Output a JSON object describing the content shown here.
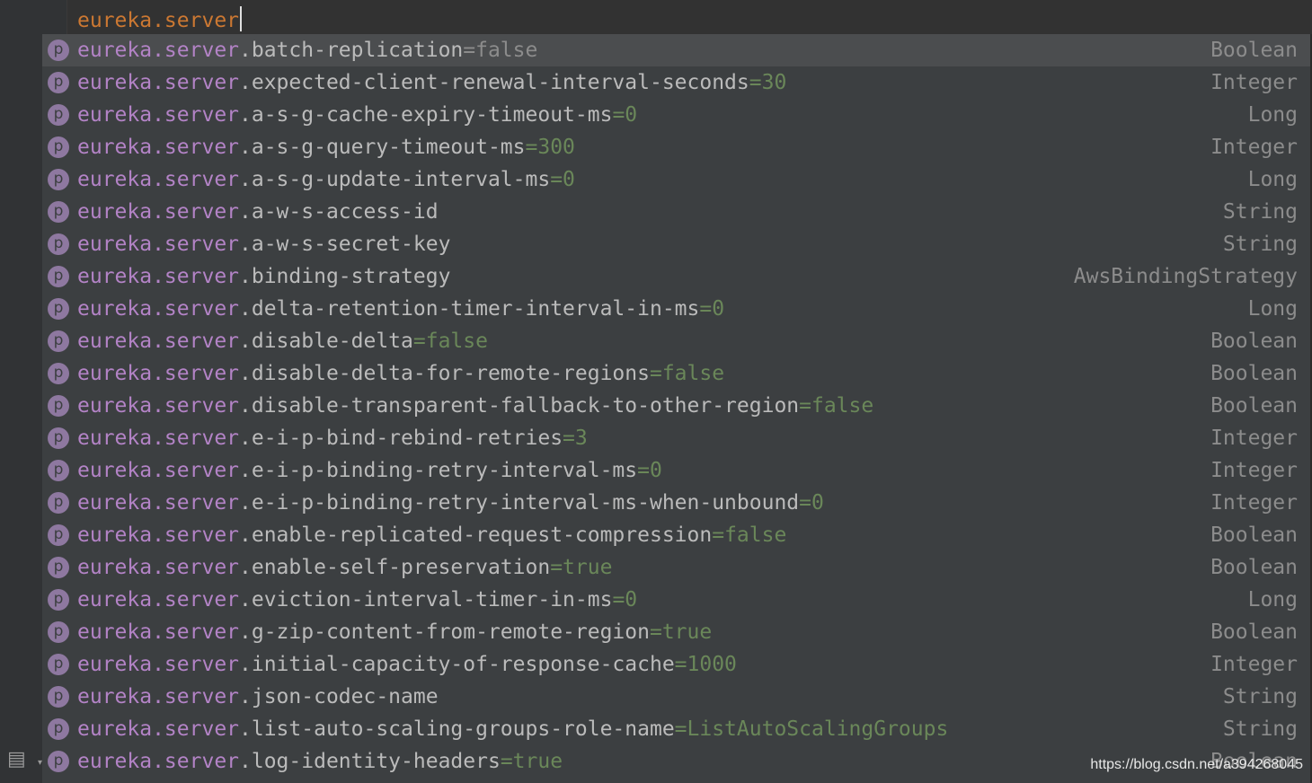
{
  "editor": {
    "typed_text": "eureka.server"
  },
  "completion": {
    "prefix": "eureka.server",
    "items": [
      {
        "suffix": ".batch-replication",
        "value": "=false",
        "type": "Boolean",
        "selected": true
      },
      {
        "suffix": ".expected-client-renewal-interval-seconds",
        "value": "=30",
        "type": "Integer"
      },
      {
        "suffix": ".a-s-g-cache-expiry-timeout-ms",
        "value": "=0",
        "type": "Long"
      },
      {
        "suffix": ".a-s-g-query-timeout-ms",
        "value": "=300",
        "type": "Integer"
      },
      {
        "suffix": ".a-s-g-update-interval-ms",
        "value": "=0",
        "type": "Long"
      },
      {
        "suffix": ".a-w-s-access-id",
        "value": "",
        "type": "String"
      },
      {
        "suffix": ".a-w-s-secret-key",
        "value": "",
        "type": "String"
      },
      {
        "suffix": ".binding-strategy",
        "value": "",
        "type": "AwsBindingStrategy"
      },
      {
        "suffix": ".delta-retention-timer-interval-in-ms",
        "value": "=0",
        "type": "Long"
      },
      {
        "suffix": ".disable-delta",
        "value": "=false",
        "type": "Boolean"
      },
      {
        "suffix": ".disable-delta-for-remote-regions",
        "value": "=false",
        "type": "Boolean"
      },
      {
        "suffix": ".disable-transparent-fallback-to-other-region",
        "value": "=false",
        "type": "Boolean"
      },
      {
        "suffix": ".e-i-p-bind-rebind-retries",
        "value": "=3",
        "type": "Integer"
      },
      {
        "suffix": ".e-i-p-binding-retry-interval-ms",
        "value": "=0",
        "type": "Integer"
      },
      {
        "suffix": ".e-i-p-binding-retry-interval-ms-when-unbound",
        "value": "=0",
        "type": "Integer"
      },
      {
        "suffix": ".enable-replicated-request-compression",
        "value": "=false",
        "type": "Boolean"
      },
      {
        "suffix": ".enable-self-preservation",
        "value": "=true",
        "type": "Boolean"
      },
      {
        "suffix": ".eviction-interval-timer-in-ms",
        "value": "=0",
        "type": "Long"
      },
      {
        "suffix": ".g-zip-content-from-remote-region",
        "value": "=true",
        "type": "Boolean"
      },
      {
        "suffix": ".initial-capacity-of-response-cache",
        "value": "=1000",
        "type": "Integer"
      },
      {
        "suffix": ".json-codec-name",
        "value": "",
        "type": "String"
      },
      {
        "suffix": ".list-auto-scaling-groups-role-name",
        "value": "=ListAutoScalingGroups",
        "type": "String"
      },
      {
        "suffix": ".log-identity-headers",
        "value": "=true",
        "type": "Boolean"
      }
    ],
    "icon_letter": "p",
    "icon_name": "property-icon"
  },
  "watermark": "https://blog.csdn.net/a394268045",
  "colors": {
    "keyword_orange": "#cc7832",
    "prefix_purple": "#b383c6",
    "value_green": "#6a8759",
    "popup_bg": "#3c3f41"
  }
}
